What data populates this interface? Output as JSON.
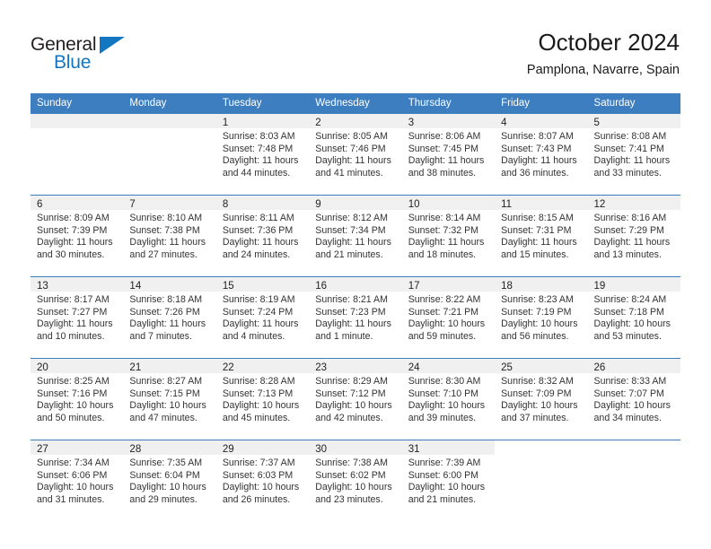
{
  "brand": {
    "name_line1": "General",
    "name_line2": "Blue",
    "logo_icon": "blue-triangle-logo",
    "color_dark": "#231f20",
    "color_blue": "#1277c0"
  },
  "header": {
    "title": "October 2024",
    "subtitle": "Pamplona, Navarre, Spain"
  },
  "calendar": {
    "accent_color": "#3c7ebf",
    "daynum_band_color": "#f0f0f0",
    "weekday_headers": [
      "Sunday",
      "Monday",
      "Tuesday",
      "Wednesday",
      "Thursday",
      "Friday",
      "Saturday"
    ],
    "weeks": [
      [
        {
          "day": "",
          "lines": []
        },
        {
          "day": "",
          "lines": []
        },
        {
          "day": "1",
          "lines": [
            "Sunrise: 8:03 AM",
            "Sunset: 7:48 PM",
            "Daylight: 11 hours",
            "and 44 minutes."
          ]
        },
        {
          "day": "2",
          "lines": [
            "Sunrise: 8:05 AM",
            "Sunset: 7:46 PM",
            "Daylight: 11 hours",
            "and 41 minutes."
          ]
        },
        {
          "day": "3",
          "lines": [
            "Sunrise: 8:06 AM",
            "Sunset: 7:45 PM",
            "Daylight: 11 hours",
            "and 38 minutes."
          ]
        },
        {
          "day": "4",
          "lines": [
            "Sunrise: 8:07 AM",
            "Sunset: 7:43 PM",
            "Daylight: 11 hours",
            "and 36 minutes."
          ]
        },
        {
          "day": "5",
          "lines": [
            "Sunrise: 8:08 AM",
            "Sunset: 7:41 PM",
            "Daylight: 11 hours",
            "and 33 minutes."
          ]
        }
      ],
      [
        {
          "day": "6",
          "lines": [
            "Sunrise: 8:09 AM",
            "Sunset: 7:39 PM",
            "Daylight: 11 hours",
            "and 30 minutes."
          ]
        },
        {
          "day": "7",
          "lines": [
            "Sunrise: 8:10 AM",
            "Sunset: 7:38 PM",
            "Daylight: 11 hours",
            "and 27 minutes."
          ]
        },
        {
          "day": "8",
          "lines": [
            "Sunrise: 8:11 AM",
            "Sunset: 7:36 PM",
            "Daylight: 11 hours",
            "and 24 minutes."
          ]
        },
        {
          "day": "9",
          "lines": [
            "Sunrise: 8:12 AM",
            "Sunset: 7:34 PM",
            "Daylight: 11 hours",
            "and 21 minutes."
          ]
        },
        {
          "day": "10",
          "lines": [
            "Sunrise: 8:14 AM",
            "Sunset: 7:32 PM",
            "Daylight: 11 hours",
            "and 18 minutes."
          ]
        },
        {
          "day": "11",
          "lines": [
            "Sunrise: 8:15 AM",
            "Sunset: 7:31 PM",
            "Daylight: 11 hours",
            "and 15 minutes."
          ]
        },
        {
          "day": "12",
          "lines": [
            "Sunrise: 8:16 AM",
            "Sunset: 7:29 PM",
            "Daylight: 11 hours",
            "and 13 minutes."
          ]
        }
      ],
      [
        {
          "day": "13",
          "lines": [
            "Sunrise: 8:17 AM",
            "Sunset: 7:27 PM",
            "Daylight: 11 hours",
            "and 10 minutes."
          ]
        },
        {
          "day": "14",
          "lines": [
            "Sunrise: 8:18 AM",
            "Sunset: 7:26 PM",
            "Daylight: 11 hours",
            "and 7 minutes."
          ]
        },
        {
          "day": "15",
          "lines": [
            "Sunrise: 8:19 AM",
            "Sunset: 7:24 PM",
            "Daylight: 11 hours",
            "and 4 minutes."
          ]
        },
        {
          "day": "16",
          "lines": [
            "Sunrise: 8:21 AM",
            "Sunset: 7:23 PM",
            "Daylight: 11 hours",
            "and 1 minute."
          ]
        },
        {
          "day": "17",
          "lines": [
            "Sunrise: 8:22 AM",
            "Sunset: 7:21 PM",
            "Daylight: 10 hours",
            "and 59 minutes."
          ]
        },
        {
          "day": "18",
          "lines": [
            "Sunrise: 8:23 AM",
            "Sunset: 7:19 PM",
            "Daylight: 10 hours",
            "and 56 minutes."
          ]
        },
        {
          "day": "19",
          "lines": [
            "Sunrise: 8:24 AM",
            "Sunset: 7:18 PM",
            "Daylight: 10 hours",
            "and 53 minutes."
          ]
        }
      ],
      [
        {
          "day": "20",
          "lines": [
            "Sunrise: 8:25 AM",
            "Sunset: 7:16 PM",
            "Daylight: 10 hours",
            "and 50 minutes."
          ]
        },
        {
          "day": "21",
          "lines": [
            "Sunrise: 8:27 AM",
            "Sunset: 7:15 PM",
            "Daylight: 10 hours",
            "and 47 minutes."
          ]
        },
        {
          "day": "22",
          "lines": [
            "Sunrise: 8:28 AM",
            "Sunset: 7:13 PM",
            "Daylight: 10 hours",
            "and 45 minutes."
          ]
        },
        {
          "day": "23",
          "lines": [
            "Sunrise: 8:29 AM",
            "Sunset: 7:12 PM",
            "Daylight: 10 hours",
            "and 42 minutes."
          ]
        },
        {
          "day": "24",
          "lines": [
            "Sunrise: 8:30 AM",
            "Sunset: 7:10 PM",
            "Daylight: 10 hours",
            "and 39 minutes."
          ]
        },
        {
          "day": "25",
          "lines": [
            "Sunrise: 8:32 AM",
            "Sunset: 7:09 PM",
            "Daylight: 10 hours",
            "and 37 minutes."
          ]
        },
        {
          "day": "26",
          "lines": [
            "Sunrise: 8:33 AM",
            "Sunset: 7:07 PM",
            "Daylight: 10 hours",
            "and 34 minutes."
          ]
        }
      ],
      [
        {
          "day": "27",
          "lines": [
            "Sunrise: 7:34 AM",
            "Sunset: 6:06 PM",
            "Daylight: 10 hours",
            "and 31 minutes."
          ]
        },
        {
          "day": "28",
          "lines": [
            "Sunrise: 7:35 AM",
            "Sunset: 6:04 PM",
            "Daylight: 10 hours",
            "and 29 minutes."
          ]
        },
        {
          "day": "29",
          "lines": [
            "Sunrise: 7:37 AM",
            "Sunset: 6:03 PM",
            "Daylight: 10 hours",
            "and 26 minutes."
          ]
        },
        {
          "day": "30",
          "lines": [
            "Sunrise: 7:38 AM",
            "Sunset: 6:02 PM",
            "Daylight: 10 hours",
            "and 23 minutes."
          ]
        },
        {
          "day": "31",
          "lines": [
            "Sunrise: 7:39 AM",
            "Sunset: 6:00 PM",
            "Daylight: 10 hours",
            "and 21 minutes."
          ]
        },
        {
          "day": "",
          "lines": []
        },
        {
          "day": "",
          "lines": []
        }
      ]
    ]
  }
}
